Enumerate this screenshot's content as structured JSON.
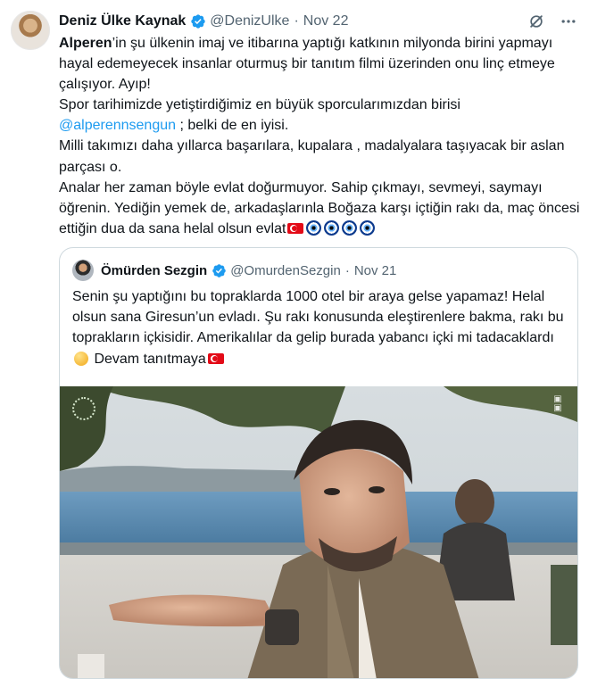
{
  "tweet": {
    "name": "Deniz Ülke Kaynak",
    "handle": "@DenizUlke",
    "separator": "·",
    "date": "Nov 22",
    "body_bold": "Alperen",
    "body_part1": "’in şu ülkenin imaj ve itibarına yaptığı katkının milyonda birini yapmayı hayal edemeyecek insanlar oturmuş bir tanıtım filmi üzerinden onu linç etmeye çalışıyor. Ayıp!\nSpor tarihimizde yetiştirdiğimiz en büyük sporcularımızdan birisi\n",
    "mention": "@alperennsengun",
    "body_part2": " ; belki de en iyisi.\nMilli takımızı daha yıllarca başarılara, kupalara , madalyalara taşıyacak bir aslan parçası o.\nAnalar her zaman böyle evlat doğurmuyor. Sahip çıkmayı, sevmeyi, saymayı öğrenin. Yediğin yemek de, arkadaşlarınla Boğaza karşı içtiğin rakı da, maç öncesi ettiğin dua da sana helal olsun evlat",
    "icons": {
      "grok": "grok-slash-icon",
      "more": "more-horizontal-icon",
      "verified": "verified-badge-icon"
    }
  },
  "quoted": {
    "name": "Ömürden Sezgin",
    "handle": "@OmurdenSezgin",
    "separator": "·",
    "date": "Nov 21",
    "text_part1": "Senin şu yaptığını bu topraklarda 1000 otel bir araya gelse yapamaz! Helal olsun sana Giresun’un evladı. Şu rakı konusunda eleştirenlere bakma, rakı bu toprakların içkisidir. Amerikalılar da gelip burada yabancı içki mi tadacaklardı",
    "text_part2": " Devam tanıtmaya"
  },
  "colors": {
    "link": "#1d9bf0",
    "muted": "#536471",
    "border": "#cfd9de"
  }
}
